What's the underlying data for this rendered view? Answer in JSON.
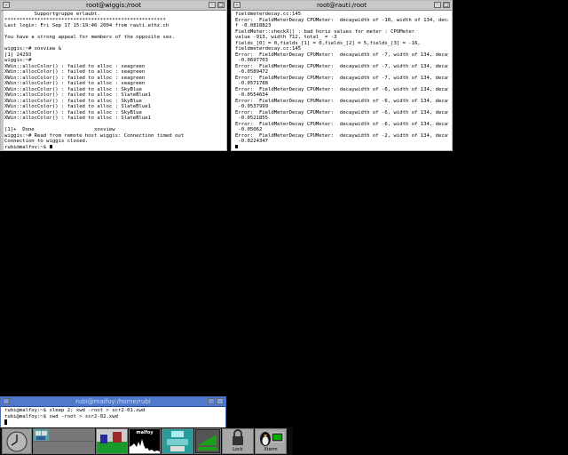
{
  "windows": {
    "left": {
      "title": "root@wiggis:/root",
      "lines": [
        "          Supportgruppe erlaubt.",
        "******************************************************",
        "Last login: Fri Sep 17 15:19:46 2004 from rauti.ethz.ch",
        "",
        "You have a strong appeal for members of the opposite sex.",
        "",
        "wiggis:~# xosview &",
        "[1] 24293",
        "wiggis:~#",
        "XWin::allocColor() : failed to alloc : seagreen",
        "XWin::allocColor() : failed to alloc : seagreen",
        "XWin::allocColor() : failed to alloc : seagreen",
        "XWin::allocColor() : failed to alloc : seagreen",
        "XWin::allocColor() : failed to alloc : SkyBlue",
        "XWin::allocColor() : failed to alloc : SlateBlue1",
        "XWin::allocColor() : failed to alloc : SkyBlue",
        "XWin::allocColor() : failed to alloc : SlateBlue1",
        "XWin::allocColor() : failed to alloc : SkyBlue",
        "XWin::allocColor() : failed to alloc : SlateBlue1",
        "",
        "[1]+  Done                    xosview",
        "wiggis:~# Read from remote host wiggis: Connection timed out",
        "Connection to wiggis closed.",
        "rubi@malfoy:~$ "
      ]
    },
    "right": {
      "title": "root@rauti:/root",
      "lines": [
        "fieldmeterdecay.cc:145",
        "Error:  FieldMeterDecay CPUMeter:  decaywidth of -10, width of 134, decay_[3] o",
        "f -0.0818823",
        "FieldMeter::checkX() : bad horiz values for meter : CPUMeter",
        "value -913, width 712, total_ = -3",
        "fields_[0] = 0,fields_[1] = 0,fields_[2] = 5,fields_[3] = -16,",
        "fieldmeterdecay.cc:145",
        "Error:  FieldMeterDecay CPUMeter:  decaywidth of -7, width of 134, decay_[3] of",
        " -0.0697703",
        "Error:  FieldMeterDecay CPUMeter:  decaywidth of -7, width of 134, decay_[3] of",
        " -0.0589472",
        "Error:  FieldMeterDecay CPUMeter:  decaywidth of -7, width of 134, decay_[3] of",
        " -0.0571788",
        "Error:  FieldMeterDecay CPUMeter:  decaywidth of -6, width of 134, decay_[3] of",
        " -0.0554634",
        "Error:  FieldMeterDecay CPUMeter:  decaywidth of -6, width of 134, decay_[3] of",
        " -0.0537999",
        "Error:  FieldMeterDecay CPUMeter:  decaywidth of -6, width of 134, decay_[3] of",
        " -0.0521855",
        "Error:  FieldMeterDecay CPUMeter:  decaywidth of -6, width of 134, decay_[3] of",
        " -0.05062",
        "Error:  FieldMeterDecay CPUMeter:  decaywidth of -2, width of 134, decay_[3] of",
        " -0.0224347",
        ""
      ]
    },
    "bottom": {
      "title": "rubi@malfoy:/home/rubi",
      "lines": [
        "rubi@malfoy:~$ sleep 2; xwd -root > scr2-01.xwd",
        "rubi@malfoy:~$ xwd -root > scr2-02.xwd",
        ""
      ]
    }
  },
  "taskbar": {
    "xload_label": "malfoy",
    "lock_label": "Lock",
    "xterm_label": "Xterm"
  },
  "colors": {
    "titlebar": "#c8c8c8",
    "active_titlebar": "#4f7acc",
    "desktop": "#000000"
  }
}
